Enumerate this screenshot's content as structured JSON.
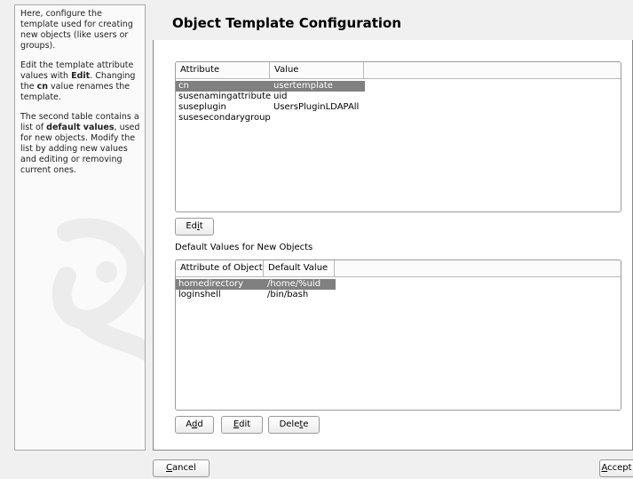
{
  "help": {
    "p1": "Here, configure the template used for creating new objects (like users or groups).",
    "p2_a": "Edit the template attribute values with ",
    "p2_b": "Edit",
    "p2_c": ". Changing the ",
    "p2_d": "cn",
    "p2_e": " value renames the template.",
    "p3_a": "The second table contains a list of ",
    "p3_b": "default values",
    "p3_c": ", used for new objects. Modify the list by adding new values and editing or removing current ones."
  },
  "title": "Object Template Configuration",
  "template_table": {
    "headers": [
      "Attribute",
      "Value"
    ],
    "rows": [
      {
        "attribute": "cn",
        "value": "usertemplate",
        "selected": true
      },
      {
        "attribute": "susenamingattribute",
        "value": "uid",
        "selected": false
      },
      {
        "attribute": "suseplugin",
        "value": "UsersPluginLDAPAll",
        "selected": false
      },
      {
        "attribute": "susesecondarygroup",
        "value": "",
        "selected": false
      }
    ]
  },
  "edit_button": {
    "pre": "Ed",
    "u": "i",
    "post": "t"
  },
  "defaults_label": "Default Values for New Objects",
  "defaults_table": {
    "headers": [
      "Attribute of Object",
      "Default Value"
    ],
    "rows": [
      {
        "attribute": "homedirectory",
        "value": "/home/%uid",
        "selected": true
      },
      {
        "attribute": "loginshell",
        "value": "/bin/bash",
        "selected": false
      }
    ]
  },
  "add_button": {
    "pre": "A",
    "u": "d",
    "post": "d"
  },
  "edit2_button": {
    "pre": "",
    "u": "E",
    "post": "dit"
  },
  "delete_button": {
    "pre": "Dele",
    "u": "t",
    "post": "e"
  },
  "cancel_button": {
    "pre": "",
    "u": "C",
    "post": "ancel"
  },
  "accept_button": {
    "pre": "",
    "u": "A",
    "post": "ccept"
  }
}
